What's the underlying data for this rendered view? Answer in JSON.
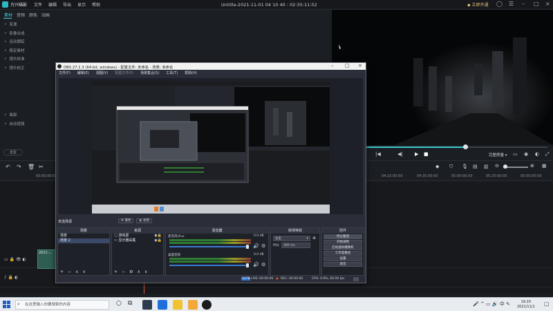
{
  "editor": {
    "app_name": "万兴喵影",
    "menu": [
      "文件",
      "编辑",
      "导出",
      "显示",
      "帮助"
    ],
    "title": "Untitle-2021-11-01 04 10 40 : 02:35:11:52",
    "vip_label": "立即开通",
    "tabs": [
      "素材",
      "音频",
      "颜色",
      "动画"
    ],
    "sidebar_items": [
      "变速",
      "影像合成",
      "运动跟踪",
      "稳定素材",
      "镜头校准",
      "镜头校正"
    ],
    "sidebar_items_2": [
      "面部",
      "自动增强"
    ],
    "collapse_label": "重置",
    "quality_label": "完整质量",
    "ruler_ticks": [
      "00:00:00:00",
      "04:10:00:00",
      "04:35:00:00",
      "05:00:00:00",
      "05:25:00:00",
      "05:50:00:00"
    ],
    "clip_label": "2021-...",
    "progress": 0.61
  },
  "obs": {
    "title": "OBS 27.1.3 (64-bit, windows) - 配置文件: 未命名 - 场景: 未命名",
    "menu": [
      "文件(F)",
      "编辑(E)",
      "视图(V)",
      "配置文件(P)",
      "场景集合(S)",
      "工具(T)",
      "帮助(H)"
    ],
    "no_source_label": "未选择源",
    "props_buttons": [
      "属性",
      "滤镜"
    ],
    "scenes": {
      "header": "场景",
      "items": [
        "场景",
        "场景 2"
      ],
      "selected": 1
    },
    "sources": {
      "header": "来源",
      "items": [
        "游戏源",
        "显示器采集"
      ]
    },
    "mixer": {
      "header": "混音器",
      "channels": [
        {
          "name": "麦克风/Aux",
          "db": "0.0 dB"
        },
        {
          "name": "桌面音频",
          "db": "0.0 dB"
        }
      ]
    },
    "transitions": {
      "header": "转场特效",
      "type": "淡出",
      "duration_label": "时长",
      "duration_value": "300 ms"
    },
    "controls": {
      "header": "控件",
      "buttons": [
        "停止推流",
        "开始录制",
        "启动虚拟摄像机",
        "工作室模式",
        "设置",
        "退出"
      ]
    },
    "status": {
      "live": "LIVE:",
      "live_time": "00:00:00",
      "rec": "REC:",
      "rec_time": "00:00:00",
      "cpu": "CPU: 0.9%, 60.00 fps",
      "kbps": "12 kb/s",
      "badge": "1278"
    }
  },
  "taskbar": {
    "search_placeholder": "在这里输入你要搜索的内容",
    "time": "19:20",
    "date": "2021/11/1"
  },
  "colors": {
    "accent": "#3fc9d0",
    "obs_bg": "#2b2e38",
    "editor_bg": "#1b1e23"
  }
}
